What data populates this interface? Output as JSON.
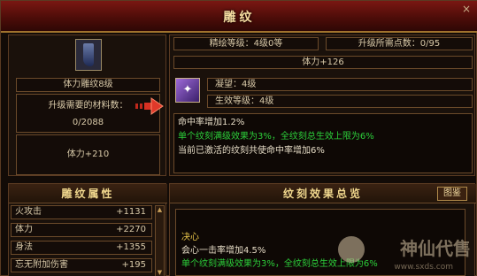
{
  "window": {
    "title": "雕纹",
    "close": "×"
  },
  "item": {
    "icon": "boots-icon",
    "name": "体力雕纹8级",
    "material_label": "升级需要的材料数：",
    "material_value": "0/2088",
    "stat": "体力+210"
  },
  "info": {
    "level": "精绘等级：4级0等",
    "points": "升级所需点数：0/95",
    "bonus": "体力+126",
    "gem_icon": "rune-gem-icon",
    "gem_glyph": "✦",
    "ning": "凝望：4级",
    "effect_level": "生效等级：4级",
    "effect_lines": [
      {
        "text": "命中率增加1.2%",
        "color": "white"
      },
      {
        "text": "单个纹刻满级效果为3%，全纹刻总生效上限为6%",
        "color": "green"
      },
      {
        "text": "当前已激活的纹刻共使命中率增加6%",
        "color": "white"
      }
    ]
  },
  "attributes": {
    "title": "雕纹属性",
    "rows": [
      {
        "name": "火攻击",
        "value": "+1131"
      },
      {
        "name": "体力",
        "value": "+2270"
      },
      {
        "name": "身法",
        "value": "+1355"
      },
      {
        "name": "忘无附加伤害",
        "value": "+195"
      }
    ]
  },
  "summary": {
    "title": "纹刻效果总览",
    "atlas_button": "图鉴",
    "category": "决心",
    "lines": [
      {
        "text": "会心一击率增加4.5%",
        "color": "white"
      },
      {
        "text": "单个纹刻满级效果为3%，全纹刻总生效上限为6%",
        "color": "green"
      }
    ]
  },
  "watermark": {
    "text": "神仙代售",
    "url": "www.sxds.com"
  }
}
